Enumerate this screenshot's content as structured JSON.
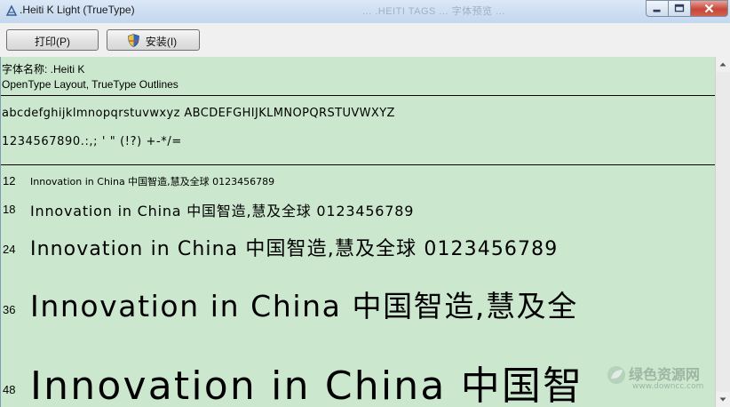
{
  "window": {
    "title": ".Heiti K Light (TrueType)",
    "ghost_title": "... .HEITI TAGS ... 字体预览 ..."
  },
  "toolbar": {
    "print_label": "打印(P)",
    "install_label": "安装(I)"
  },
  "font_info": {
    "name_line": "字体名称: .Heiti K",
    "format_line": "OpenType Layout, TrueType Outlines"
  },
  "charset": {
    "lowercase_uppercase": "abcdefghijklmnopqrstuvwxyz ABCDEFGHIJKLMNOPQRSTUVWXYZ",
    "digits_symbols": "1234567890.:,; ' \" (!?) +-*/="
  },
  "samples": [
    {
      "size": "12",
      "text": "Innovation in China 中国智造,慧及全球 0123456789"
    },
    {
      "size": "18",
      "text": "Innovation in China 中国智造,慧及全球 0123456789"
    },
    {
      "size": "24",
      "text": "Innovation in China 中国智造,慧及全球 0123456789"
    },
    {
      "size": "36",
      "text": "Innovation in China 中国智造,慧及全"
    },
    {
      "size": "48",
      "text": "Innovation in China 中国智"
    }
  ],
  "watermark": {
    "line1": "绿色资源网",
    "line2": "www.downcc.com"
  },
  "colors": {
    "preview_bg": "#cbe8cf",
    "titlebar": "#c3d7ee",
    "close_button": "#c7473a"
  }
}
